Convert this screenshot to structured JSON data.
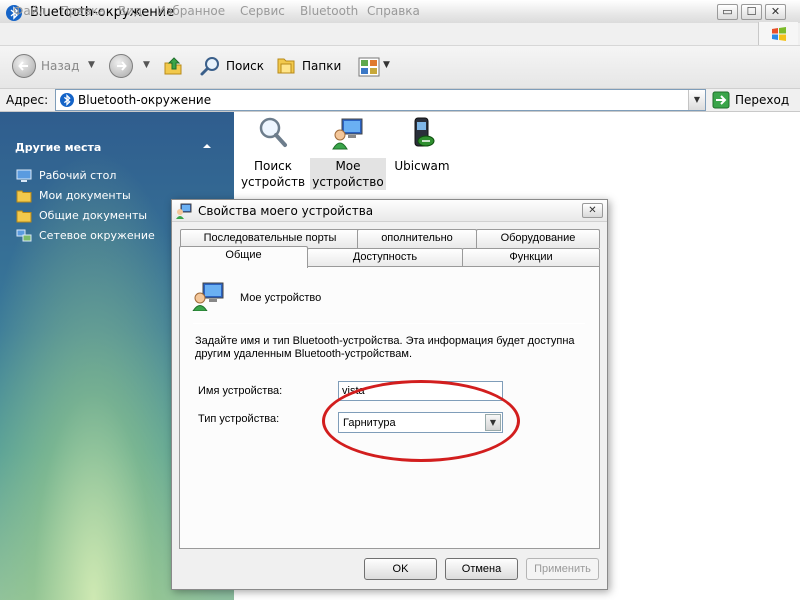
{
  "window": {
    "title": "Bluetooth-окружение",
    "min_glyph": "▭",
    "max_glyph": "☐",
    "close_glyph": "✕"
  },
  "menu": [
    "Файл",
    "Правка",
    "Вид",
    "Избранное",
    "Сервис",
    "Bluetooth",
    "Справка"
  ],
  "toolbar": {
    "back": "Назад",
    "search": "Поиск",
    "folders": "Папки",
    "dropdown_glyph": "▼"
  },
  "address": {
    "label": "Адрес:",
    "value": "Bluetooth-окружение",
    "go": "Переход",
    "dropdown_glyph": "▼"
  },
  "sidebar": {
    "heading": "Другие места",
    "items": [
      {
        "label": "Рабочий стол",
        "icon": "desktop-icon"
      },
      {
        "label": "Мои документы",
        "icon": "folder-icon"
      },
      {
        "label": "Общие документы",
        "icon": "folder-icon"
      },
      {
        "label": "Сетевое окружение",
        "icon": "network-icon"
      }
    ]
  },
  "files": [
    {
      "line1": "Поиск",
      "line2": "устройств",
      "icon": "magnifier-icon"
    },
    {
      "line1": "Мое",
      "line2": "устройство",
      "icon": "computer-icon"
    },
    {
      "line1": "Ubicwam",
      "line2": "",
      "icon": "phone-icon"
    }
  ],
  "dialog": {
    "title": "Свойства моего устройства",
    "close_glyph": "✕",
    "tabs_back": [
      "Последовательные порты",
      "ополнительно",
      "Оборудование"
    ],
    "tabs_front": [
      "Общие",
      "Доступность",
      "Функции"
    ],
    "active_tab": "Общие",
    "device_name": "Мое устройство",
    "description": "Задайте имя и тип Bluetooth-устройства. Эта информация будет доступна другим удаленным Bluetooth-устройствам.",
    "name_label": "Имя устройства:",
    "name_value": "vista",
    "type_label": "Тип устройства:",
    "type_value": "Гарнитура",
    "type_dropdown_glyph": "▼",
    "buttons": {
      "ok": "OK",
      "cancel": "Отмена",
      "apply": "Применить"
    }
  },
  "colors": {
    "highlight": "#d21e1e",
    "bluetooth_blue": "#1564c8"
  }
}
